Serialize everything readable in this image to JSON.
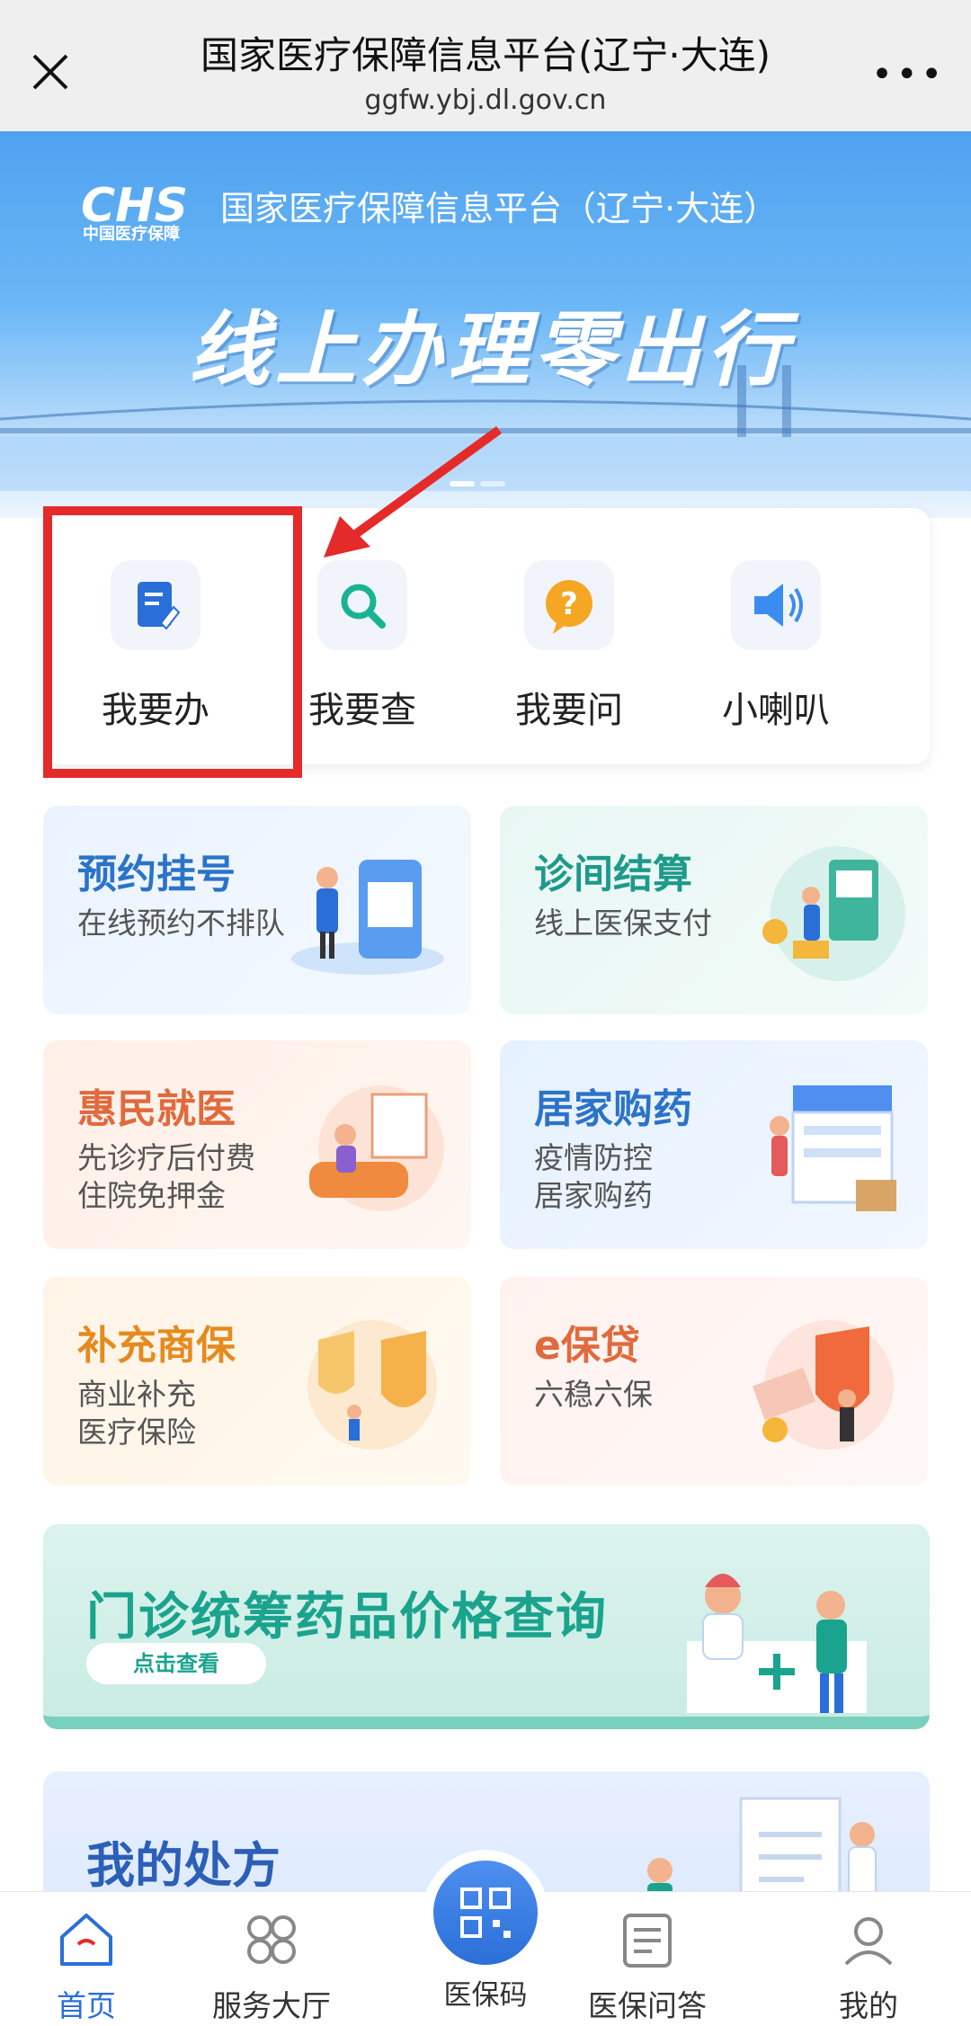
{
  "header": {
    "title": "国家医疗保障信息平台(辽宁·大连)",
    "url": "ggfw.ybj.dl.gov.cn"
  },
  "banner": {
    "logo_text": "CHS",
    "logo_sub": "中国医疗保障",
    "org": "国家医疗保障信息平台（辽宁·大连）",
    "slogan": "线上办理零出行"
  },
  "quick_actions": [
    {
      "label": "我要办",
      "icon": "document-edit-icon"
    },
    {
      "label": "我要查",
      "icon": "search-icon"
    },
    {
      "label": "我要问",
      "icon": "question-icon"
    },
    {
      "label": "小喇叭",
      "icon": "speaker-icon"
    }
  ],
  "tiles": [
    {
      "title": "预约挂号",
      "subtitle": "在线预约不排队"
    },
    {
      "title": "诊间结算",
      "subtitle": "线上医保支付"
    },
    {
      "title": "惠民就医",
      "subtitle": "先诊疗后付费\n住院免押金"
    },
    {
      "title": "居家购药",
      "subtitle": "疫情防控\n居家购药"
    },
    {
      "title": "补充商保",
      "subtitle": "商业补充\n医疗保险"
    },
    {
      "title": "e保贷",
      "subtitle": "六稳六保"
    }
  ],
  "promo": {
    "title": "门诊统筹药品价格查询",
    "button": "点击查看"
  },
  "prescription": {
    "title": "我的处方"
  },
  "bottom_nav": [
    {
      "label": "首页",
      "active": true
    },
    {
      "label": "服务大厅",
      "active": false
    },
    {
      "label": "医保码",
      "active": false
    },
    {
      "label": "医保问答",
      "active": false
    },
    {
      "label": "我的",
      "active": false
    }
  ],
  "colors": {
    "accent": "#2a6fd8",
    "highlight": "#e52a2a"
  }
}
